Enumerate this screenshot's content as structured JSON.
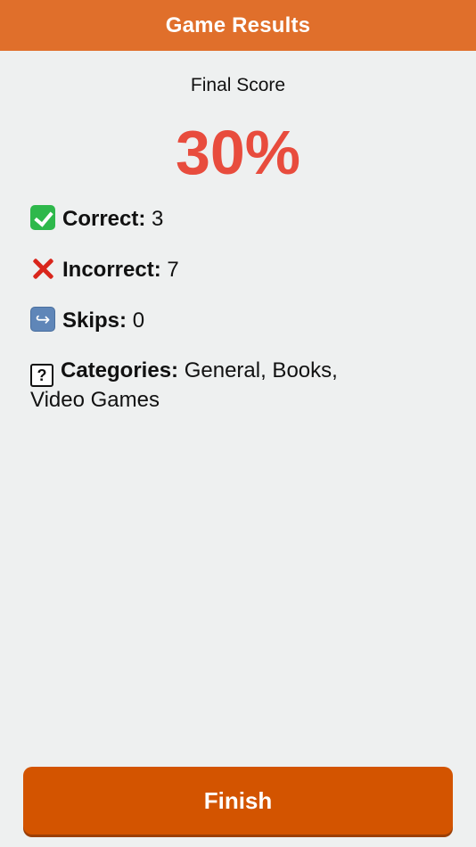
{
  "header": {
    "title": "Game Results"
  },
  "score": {
    "label": "Final Score",
    "value": "30%"
  },
  "stats": {
    "correct": {
      "icon": "check-mark-icon",
      "label": "Correct:",
      "value": " 3"
    },
    "incorrect": {
      "icon": "cross-mark-icon",
      "label": "Incorrect:",
      "value": " 7"
    },
    "skips": {
      "icon": "skip-arrow-icon",
      "label": "Skips:",
      "value": " 0"
    },
    "categories": {
      "icon": "question-box-icon",
      "label": "Categories:",
      "value": " General, Books, Video Games"
    }
  },
  "actions": {
    "finish_label": "Finish"
  },
  "colors": {
    "header": "#e06f2b",
    "score": "#e84c3d",
    "button": "#d35400",
    "background": "#eef0f0"
  }
}
